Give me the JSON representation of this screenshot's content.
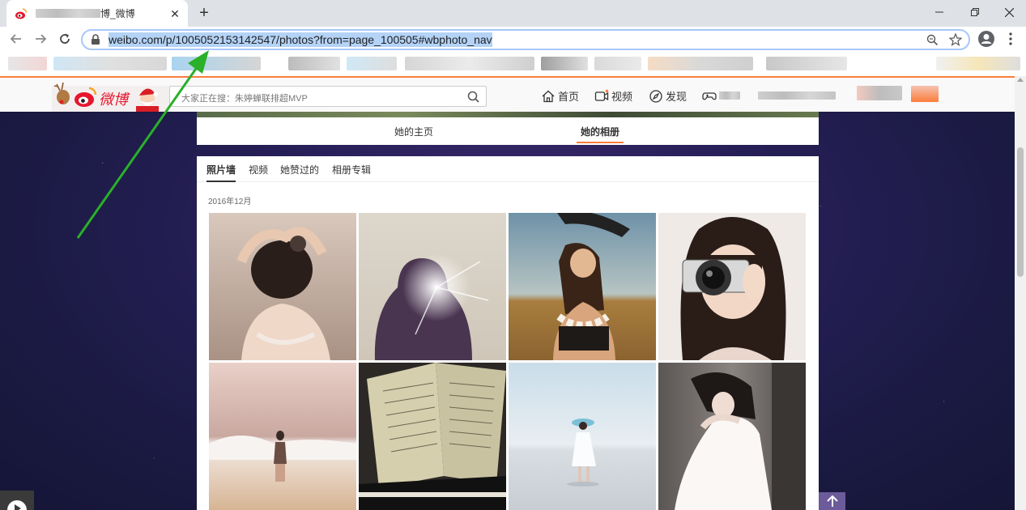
{
  "browser": {
    "tab": {
      "title_suffix": "博_微博",
      "favicon": "weibo-icon",
      "close_icon": "close-icon"
    },
    "new_tab_icon": "plus-icon",
    "window_controls": [
      "minimize-icon",
      "restore-icon",
      "close-icon"
    ],
    "url": "weibo.com/p/1005052153142547/photos?from=page_100505#wbphoto_nav",
    "accent_color": "#a8c7fa"
  },
  "weibo": {
    "logo_text": "微博",
    "search": {
      "placeholder": "大家正在搜：朱婷蝉联排超MVP"
    },
    "nav": {
      "home": "首页",
      "video": "视频",
      "discover": "发现"
    },
    "brand_color": "#fa7d3c"
  },
  "profile_tabs": {
    "home": "她的主页",
    "album": "她的相册"
  },
  "album": {
    "tabs": [
      "照片墙",
      "视频",
      "她赞过的",
      "相册专辑"
    ],
    "active_tab": 0,
    "date": "2016年12月",
    "photos": [
      {
        "name": "photo-girl-hands-on-head"
      },
      {
        "name": "photo-silhouette-sunlight"
      },
      {
        "name": "photo-girl-flower-lei"
      },
      {
        "name": "photo-girl-with-camera"
      },
      {
        "name": "photo-girl-at-beach-waves"
      },
      {
        "name": "photo-sheet-music-piano"
      },
      {
        "name": "photo-girl-on-beach-hat"
      },
      {
        "name": "photo-girl-white-dress"
      }
    ]
  }
}
